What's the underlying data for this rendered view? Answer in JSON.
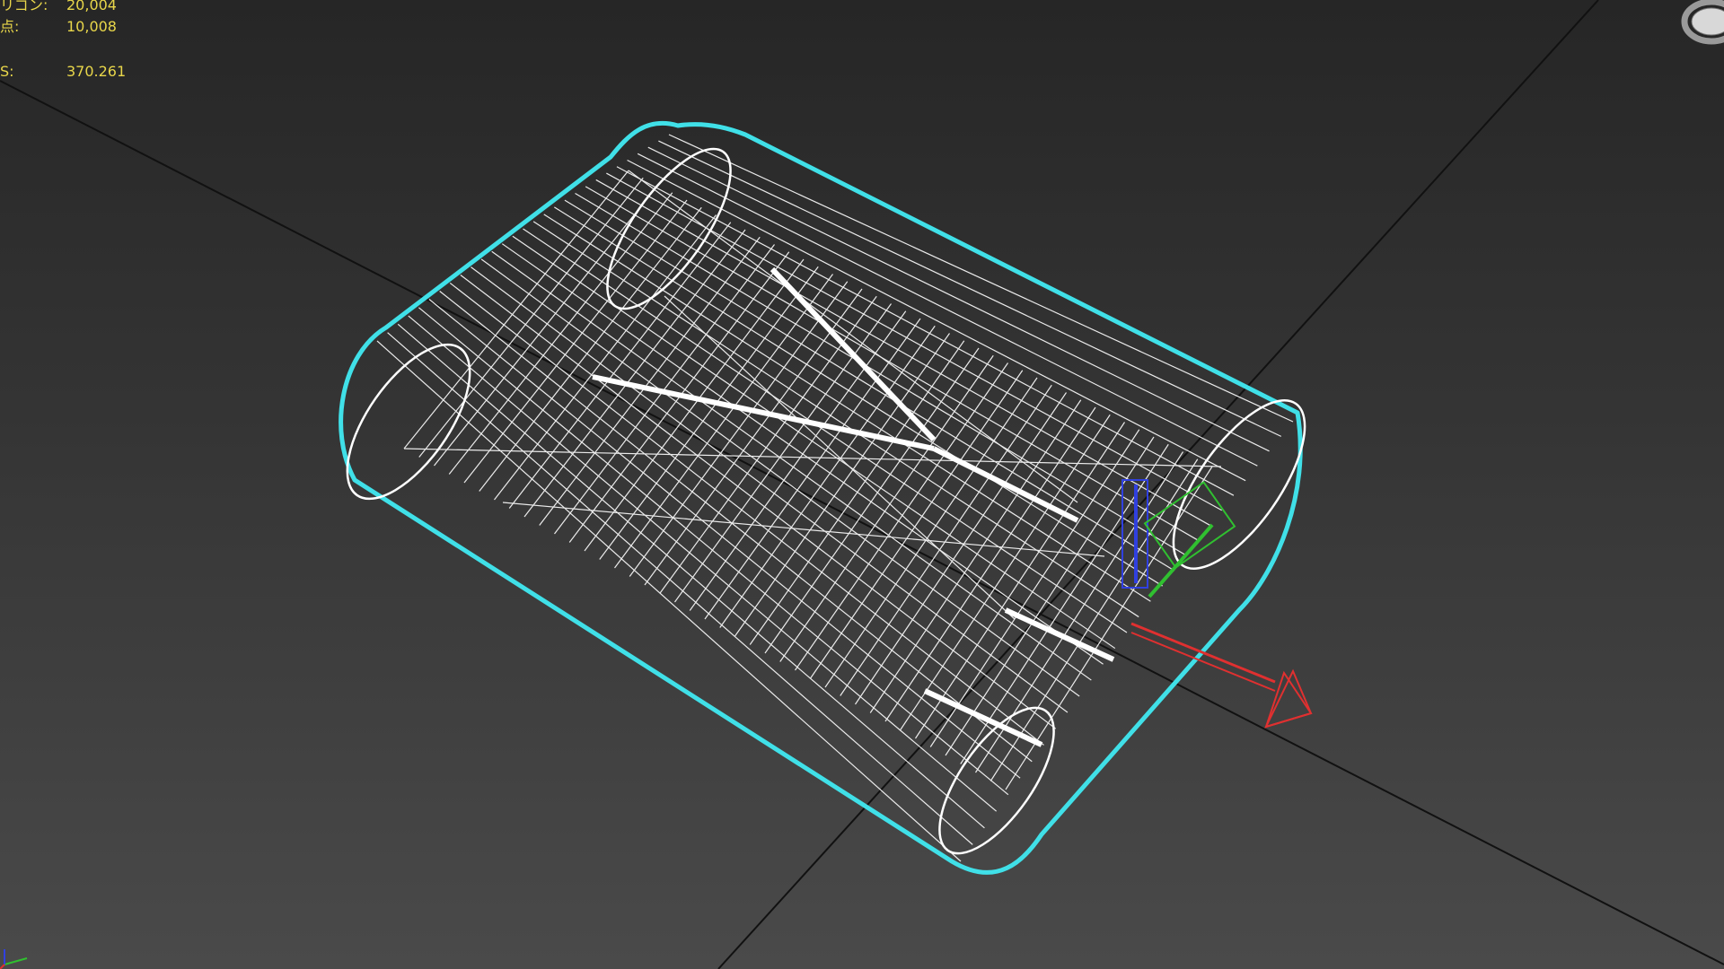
{
  "viewport": {
    "stats": {
      "polygons_label": "リゴン:",
      "polygons_value": "20,004",
      "vertices_label": "点:",
      "vertices_value": "10,008",
      "fps_label": "S:",
      "fps_value": "370.261"
    },
    "display_mode": "wireframe",
    "selection_color": "#40e0e8",
    "wire_color": "#ffffff",
    "grid_color": "#111111"
  },
  "gizmo": {
    "x_color": "#e03030",
    "y_color": "#30c030",
    "z_color": "#3040e0"
  },
  "icons": {
    "viewcube": "viewcube-icon",
    "axis_tripod": "axis-tripod-icon"
  }
}
